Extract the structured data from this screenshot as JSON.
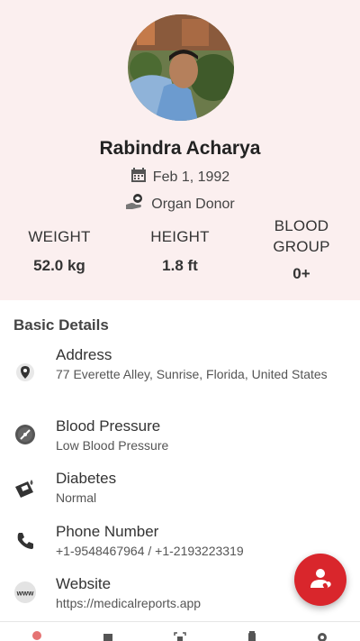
{
  "profile": {
    "name": "Rabindra Acharya",
    "dob": "Feb 1, 1992",
    "donor_status": "Organ Donor"
  },
  "stats": {
    "weight": {
      "label": "WEIGHT",
      "value": "52.0 kg"
    },
    "height": {
      "label": "HEIGHT",
      "value": "1.8 ft"
    },
    "blood_group": {
      "label_line1": "BLOOD",
      "label_line2": "GROUP",
      "value": "0+"
    }
  },
  "basic_details": {
    "title": "Basic Details",
    "items": [
      {
        "title": "Address",
        "value": "77 Everette Alley, Sunrise, Florida, United States",
        "icon": "location-pin-icon"
      },
      {
        "title": "Blood Pressure",
        "value": "Low Blood Pressure",
        "icon": "blood-pressure-gauge-icon"
      },
      {
        "title": "Diabetes",
        "value": "Normal",
        "icon": "glucose-meter-icon"
      },
      {
        "title": "Phone Number",
        "value": "+1-9548467964 / +1-2193223319",
        "icon": "phone-icon"
      },
      {
        "title": "Website",
        "value": "https://medicalreports.app",
        "icon": "www-icon"
      }
    ]
  },
  "colors": {
    "header_bg": "#fbefef",
    "accent_red": "#d9262c"
  }
}
